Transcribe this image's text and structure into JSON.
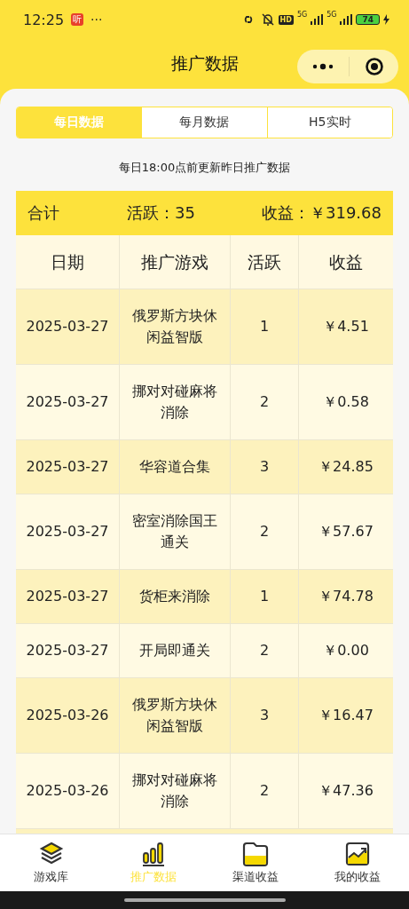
{
  "status_bar": {
    "time": "12:25",
    "app_badge": "听",
    "more": "···",
    "hd": "HD",
    "network_1": "5G",
    "network_2": "5G",
    "battery": "74"
  },
  "header": {
    "title": "推广数据"
  },
  "tabs": [
    {
      "label": "每日数据",
      "selected": true
    },
    {
      "label": "每月数据",
      "selected": false
    },
    {
      "label": "H5实时",
      "selected": false
    }
  ],
  "note": "每日18:00点前更新昨日推广数据",
  "summary": {
    "label": "合计",
    "active": "活跃：35",
    "income": "收益：￥319.68"
  },
  "table": {
    "columns": [
      "日期",
      "推广游戏",
      "活跃",
      "收益"
    ],
    "rows": [
      [
        "2025-03-27",
        "俄罗斯方块休闲益智版",
        "1",
        "￥4.51"
      ],
      [
        "2025-03-27",
        "挪对对碰麻将消除",
        "2",
        "￥0.58"
      ],
      [
        "2025-03-27",
        "华容道合集",
        "3",
        "￥24.85"
      ],
      [
        "2025-03-27",
        "密室消除国王通关",
        "2",
        "￥57.67"
      ],
      [
        "2025-03-27",
        "货柜来消除",
        "1",
        "￥74.78"
      ],
      [
        "2025-03-27",
        "开局即通关",
        "2",
        "￥0.00"
      ],
      [
        "2025-03-26",
        "俄罗斯方块休闲益智版",
        "3",
        "￥16.47"
      ],
      [
        "2025-03-26",
        "挪对对碰麻将消除",
        "2",
        "￥47.36"
      ]
    ]
  },
  "bottom_nav": [
    {
      "label": "游戏库",
      "kind": "layers",
      "selected": false
    },
    {
      "label": "推广数据",
      "kind": "bars",
      "selected": true
    },
    {
      "label": "渠道收益",
      "kind": "folder",
      "selected": false
    },
    {
      "label": "我的收益",
      "kind": "chart",
      "selected": false
    }
  ]
}
